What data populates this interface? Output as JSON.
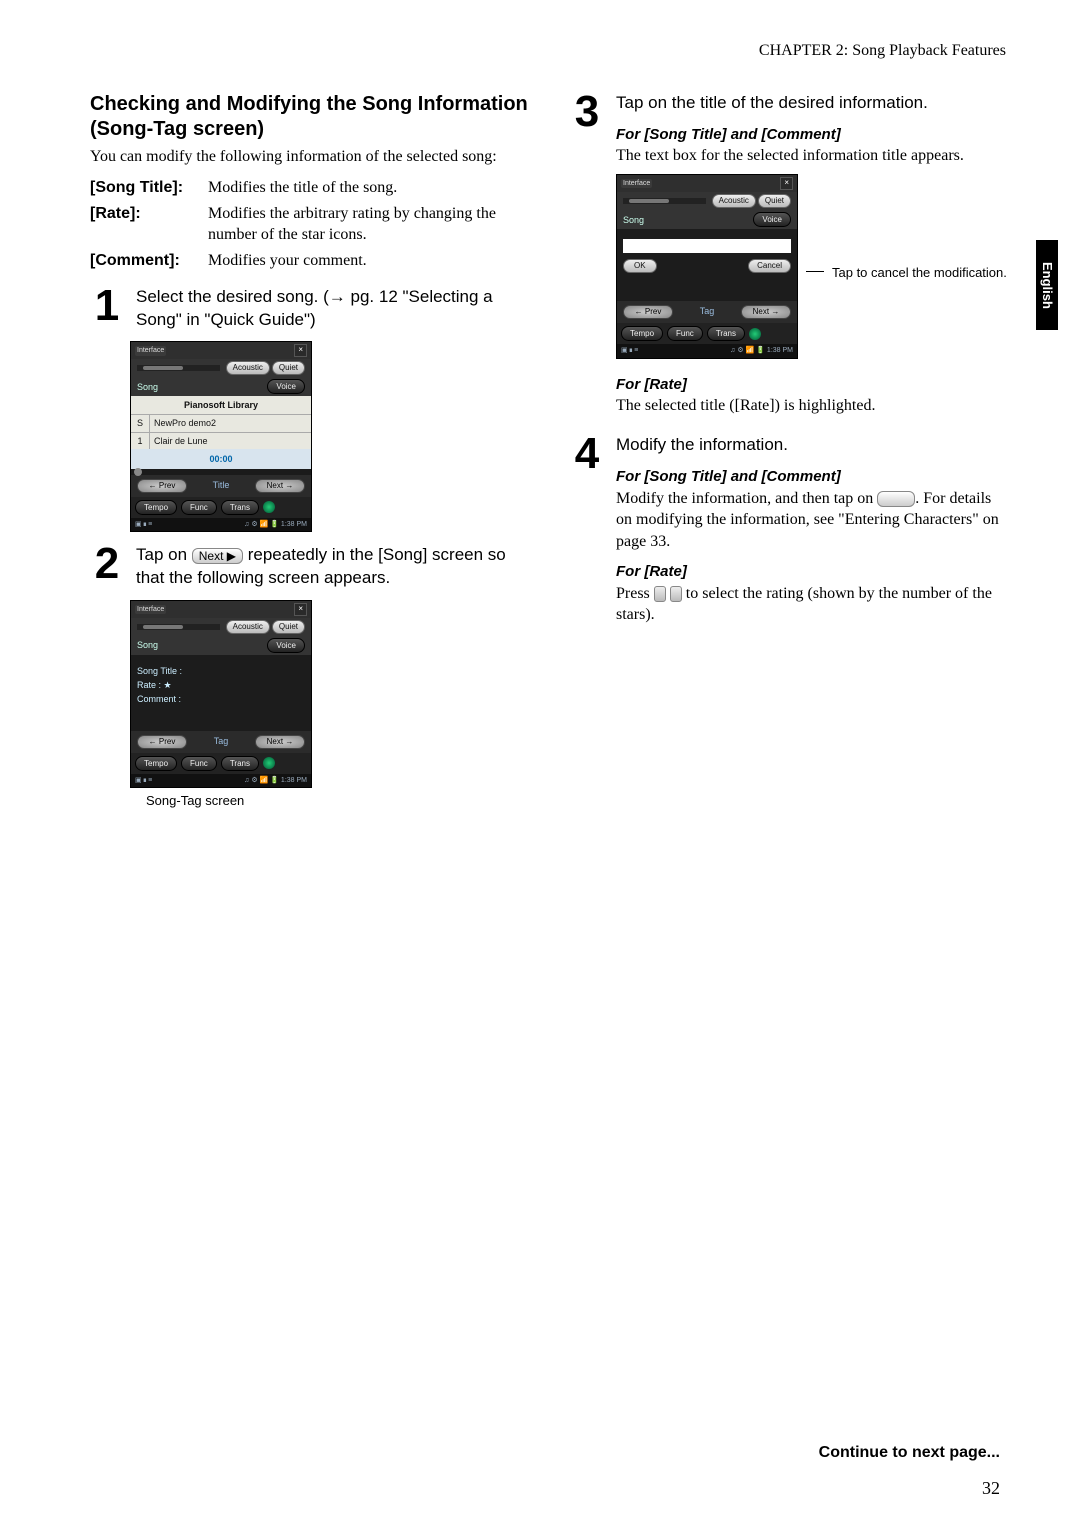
{
  "header": "CHAPTER 2: Song Playback Features",
  "side_tab": "English",
  "section_title": "Checking and Modifying the Song Information (Song-Tag screen)",
  "intro": "You can modify the following information of the selected song:",
  "defs": {
    "song_title_term": "[Song Title]:",
    "song_title_desc": "Modifies the title of the song.",
    "rate_term": "[Rate]:",
    "rate_desc": "Modifies the arbitrary rating by changing the number of the star icons.",
    "comment_term": "[Comment]:",
    "comment_desc": "Modifies your comment."
  },
  "steps": {
    "s1_num": "1",
    "s1_text_a": "Select the desired song. (",
    "s1_text_arrow": "→",
    "s1_text_b": " pg. 12 \"Selecting a Song\" in \"Quick Guide\")",
    "s2_num": "2",
    "s2_text_a": "Tap on ",
    "s2_key": "Next ▶",
    "s2_text_b": " repeatedly in the [Song] screen so that the following screen appears.",
    "s3_num": "3",
    "s3_text": "Tap on the title of the desired information.",
    "s4_num": "4",
    "s4_text": "Modify the information."
  },
  "caption2": "Song-Tag screen",
  "right": {
    "sub1_em": "For [Song Title] and [Comment]",
    "sub1_body": "The text box for the selected information title appears.",
    "callout": "Tap to cancel the modification.",
    "sub2_em": "For [Rate]",
    "sub2_body": "The selected title ([Rate]) is highlighted.",
    "sub3_em": "For [Song Title] and [Comment]",
    "sub3_body_a": "Modify the information, and then tap on ",
    "sub3_body_b": ". For details on modifying the information, see \"Entering Characters\" on page 33.",
    "sub4_em": "For [Rate]",
    "sub4_body_a": "Press ",
    "sub4_body_b": " to select the rating (shown by the number of the stars)."
  },
  "lcd_common": {
    "title_bar": "Interface",
    "close": "×",
    "acoustic": "Acoustic",
    "quiet": "Quiet",
    "song_label": "Song",
    "voice": "Voice",
    "prev": "← Prev",
    "next": "Next →",
    "tempo": "Tempo",
    "func": "Func",
    "trans": "Trans",
    "status_time": "1:38 PM"
  },
  "lcd1": {
    "list_header": "Pianosoft Library",
    "row1_idx": "S",
    "row1_lbl": "NewPro demo2",
    "row2_idx": "1",
    "row2_lbl": "Clair de Lune",
    "time": "00:00",
    "mid": "Title"
  },
  "lcd2": {
    "line1": "Song Title :",
    "line2": "Rate : ★",
    "line3": "Comment :",
    "mid": "Tag"
  },
  "lcd3": {
    "ok": "OK",
    "cancel": "Cancel",
    "mid": "Tag"
  },
  "continue": "Continue to next page...",
  "pagenum": "32"
}
